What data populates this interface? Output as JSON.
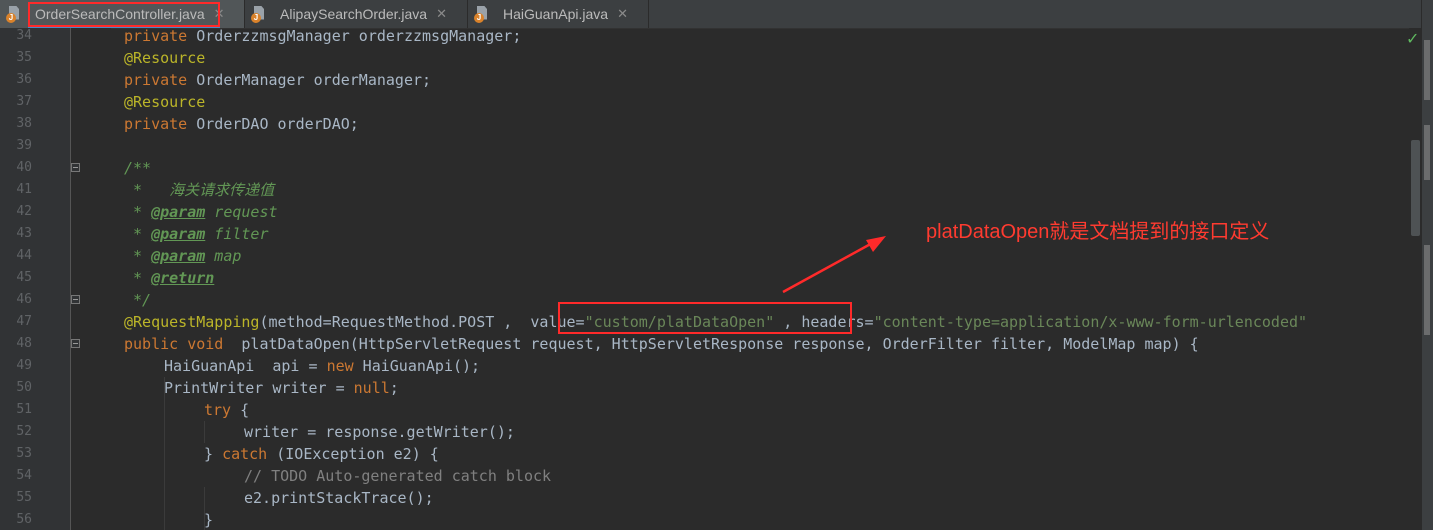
{
  "tabs": [
    {
      "label": "OrderSearchController.java",
      "active": true
    },
    {
      "label": "AlipaySearchOrder.java",
      "active": false
    },
    {
      "label": "HaiGuanApi.java",
      "active": false
    }
  ],
  "icons": {
    "close": "close-icon",
    "java_file": "java-file-icon",
    "check": "checkmark-icon"
  },
  "editor": {
    "line_numbers": [
      "34",
      "35",
      "36",
      "37",
      "38",
      "39",
      "40",
      "41",
      "42",
      "43",
      "44",
      "45",
      "46",
      "47",
      "48",
      "49",
      "50",
      "51",
      "52",
      "53",
      "54",
      "55",
      "56"
    ],
    "lines": {
      "l34": {
        "kw": "private",
        "rest": " OrderzzmsgManager orderzzmsgManager;"
      },
      "l35": {
        "an": "@Resource"
      },
      "l36": {
        "kw": "private",
        "rest": " OrderManager orderManager;"
      },
      "l37": {
        "an": "@Resource"
      },
      "l38": {
        "kw": "private",
        "rest": " OrderDAO orderDAO;"
      },
      "l40": {
        "doc": "/**"
      },
      "l41": {
        "doc": " *   海关请求传递值"
      },
      "l42": {
        "star": " * ",
        "tag": "@param",
        "name": " request"
      },
      "l43": {
        "star": " * ",
        "tag": "@param",
        "name": " filter"
      },
      "l44": {
        "star": " * ",
        "tag": "@param",
        "name": " map"
      },
      "l45": {
        "star": " * ",
        "tag": "@return"
      },
      "l46": {
        "doc": " */"
      },
      "l47": {
        "an": "@RequestMapping",
        "p1": "(method=RequestMethod.POST ,  value=",
        "s1": "\"custom/platDataOpen\"",
        "p2": " , headers=",
        "s2": "\"content-type=application/x-www-form-urlencoded\""
      },
      "l48": {
        "kw1": "public",
        "kw2": " void",
        "rest": "  platDataOpen(HttpServletRequest request, HttpServletResponse response, OrderFilter filter, ModelMap map) {"
      },
      "l49": {
        "a": "HaiGuanApi  api = ",
        "kw": "new",
        "b": " HaiGuanApi();"
      },
      "l50": {
        "a": "PrintWriter writer = ",
        "kw": "null",
        "b": ";"
      },
      "l51": {
        "kw": "try",
        "b": " {"
      },
      "l52": {
        "a": "writer = response.getWriter();"
      },
      "l53": {
        "a": "} ",
        "kw": "catch",
        "b": " (IOException e2) {"
      },
      "l54": {
        "cmt": "// TODO Auto-generated catch block"
      },
      "l55": {
        "a": "e2.printStackTrace();"
      },
      "l56": {
        "a": "}"
      }
    }
  },
  "annotation": {
    "text": "platDataOpen就是文档提到的接口定义",
    "color": "#ff3b30"
  },
  "colors": {
    "keyword": "#cc7832",
    "annotation": "#bbb529",
    "string": "#6a8759",
    "doc": "#629755",
    "highlight_box": "#ff2a2a"
  }
}
